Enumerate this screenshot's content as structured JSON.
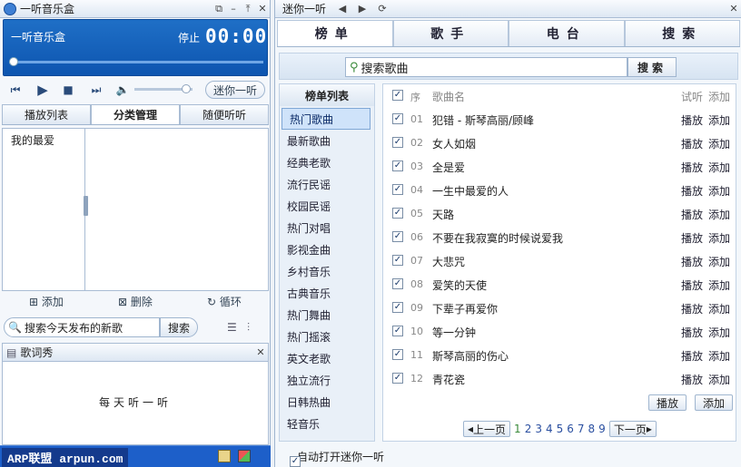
{
  "left": {
    "title": "一听音乐盒",
    "player": {
      "name": "一听音乐盒",
      "status": "停止",
      "time": "00:00",
      "progress": 0
    },
    "mini_button": "迷你一听",
    "tabs": [
      "播放列表",
      "分类管理",
      "随便听听"
    ],
    "active_tab": 1,
    "category_items": [
      "我的最爱"
    ],
    "tools": [
      "添加",
      "删除",
      "循环"
    ],
    "search": {
      "value": "搜索今天发布的新歌",
      "button": "搜索"
    },
    "lyric": {
      "title": "歌词秀",
      "text": "每天听一听"
    },
    "taskbar_label": "ARP联盟 arpun.com"
  },
  "right": {
    "title": "迷你一听",
    "tabs": [
      "榜单",
      "歌手",
      "电台",
      "搜索"
    ],
    "active_tab": 0,
    "search": {
      "placeholder": "搜索歌曲",
      "button": "搜索"
    },
    "categories": {
      "header": "榜单列表",
      "active": 0,
      "items": [
        "热门歌曲",
        "最新歌曲",
        "经典老歌",
        "流行民谣",
        "校园民谣",
        "热门对唱",
        "影视金曲",
        "乡村音乐",
        "古典音乐",
        "热门舞曲",
        "热门摇滚",
        "英文老歌",
        "独立流行",
        "日韩热曲",
        "轻音乐"
      ]
    },
    "song_table": {
      "headers": {
        "num": "序",
        "name": "歌曲名",
        "play": "试听",
        "add": "添加"
      },
      "rows": [
        {
          "num": "01",
          "name": "犯错 - 斯琴高丽/顾峰",
          "play": "播放",
          "add": "添加"
        },
        {
          "num": "02",
          "name": "女人如烟",
          "play": "播放",
          "add": "添加"
        },
        {
          "num": "03",
          "name": "全是爱",
          "play": "播放",
          "add": "添加"
        },
        {
          "num": "04",
          "name": "一生中最爱的人",
          "play": "播放",
          "add": "添加"
        },
        {
          "num": "05",
          "name": "天路",
          "play": "播放",
          "add": "添加"
        },
        {
          "num": "06",
          "name": "不要在我寂寞的时候说爱我",
          "play": "播放",
          "add": "添加"
        },
        {
          "num": "07",
          "name": "大悲咒",
          "play": "播放",
          "add": "添加"
        },
        {
          "num": "08",
          "name": "爱笑的天使",
          "play": "播放",
          "add": "添加"
        },
        {
          "num": "09",
          "name": "下辈子再爱你",
          "play": "播放",
          "add": "添加"
        },
        {
          "num": "10",
          "name": "等一分钟",
          "play": "播放",
          "add": "添加"
        },
        {
          "num": "11",
          "name": "斯琴高丽的伤心",
          "play": "播放",
          "add": "添加"
        },
        {
          "num": "12",
          "name": "青花瓷",
          "play": "播放",
          "add": "添加"
        }
      ],
      "play_button": "播放",
      "add_button": "添加"
    },
    "pager": {
      "prev": "上一页",
      "pages": [
        "1",
        "2",
        "3",
        "4",
        "5",
        "6",
        "7",
        "8",
        "9"
      ],
      "current": "1",
      "next": "下一页"
    },
    "auto_open": "自动打开迷你一听"
  }
}
